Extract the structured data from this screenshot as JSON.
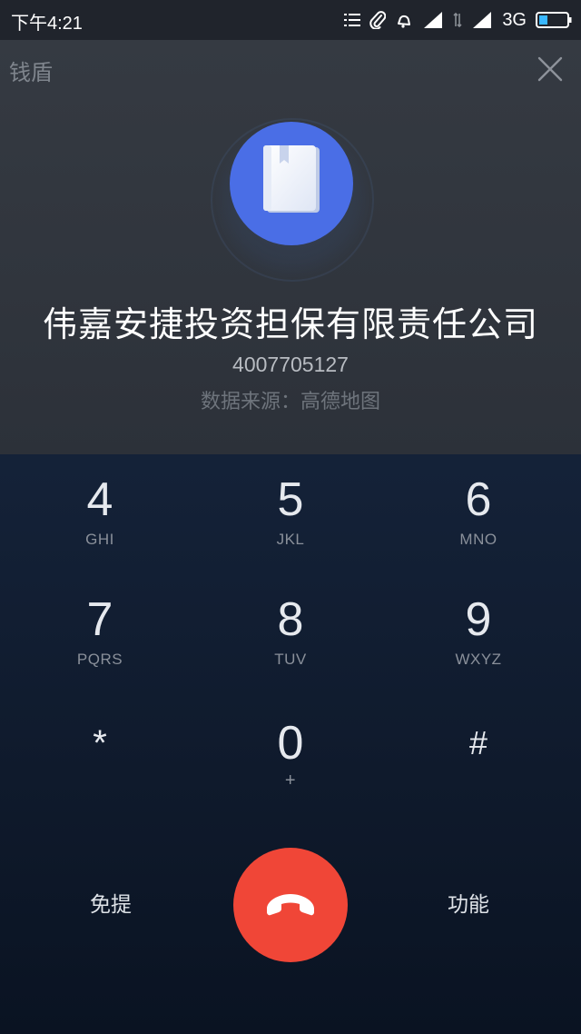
{
  "status_bar": {
    "time": "下午4:21",
    "network": "3G"
  },
  "header": {
    "app_label": "钱盾"
  },
  "caller": {
    "name": "伟嘉安捷投资担保有限责任公司",
    "number": "4007705127",
    "data_source": "数据来源：高德地图"
  },
  "keypad": {
    "keys": [
      {
        "digit": "4",
        "letters": "GHI"
      },
      {
        "digit": "5",
        "letters": "JKL"
      },
      {
        "digit": "6",
        "letters": "MNO"
      },
      {
        "digit": "7",
        "letters": "PQRS"
      },
      {
        "digit": "8",
        "letters": "TUV"
      },
      {
        "digit": "9",
        "letters": "WXYZ"
      },
      {
        "digit": "*",
        "letters": ""
      },
      {
        "digit": "0",
        "letters": "+"
      },
      {
        "digit": "#",
        "letters": ""
      }
    ]
  },
  "controls": {
    "speaker_label": "免提",
    "function_label": "功能"
  },
  "icons": {
    "avatar": "book-icon",
    "close": "close-icon",
    "hangup": "phone-hangup-icon"
  },
  "colors": {
    "hangup": "#f04637",
    "avatar": "#4a6ee6"
  }
}
